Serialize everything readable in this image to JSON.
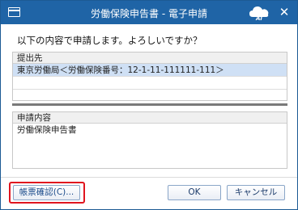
{
  "window": {
    "title": "労働保険申告書 - 電子申請",
    "badge": "AI",
    "close": "✕"
  },
  "prompt": "以下の内容で申請します。よろしいですか？",
  "destination": {
    "header": "提出先",
    "rows": [
      "東京労働局＜労働保険番号：12-1-11-111111-111＞",
      "",
      ""
    ]
  },
  "contents": {
    "header": "申請内容",
    "rows": [
      "労働保険申告書"
    ]
  },
  "buttons": {
    "preview": "帳票確認(C)...",
    "ok": "OK",
    "cancel": "キャンセル"
  },
  "colors": {
    "titlebar": "#1f64a6",
    "selection": "#cfe0f5",
    "highlight": "#e0141e"
  }
}
